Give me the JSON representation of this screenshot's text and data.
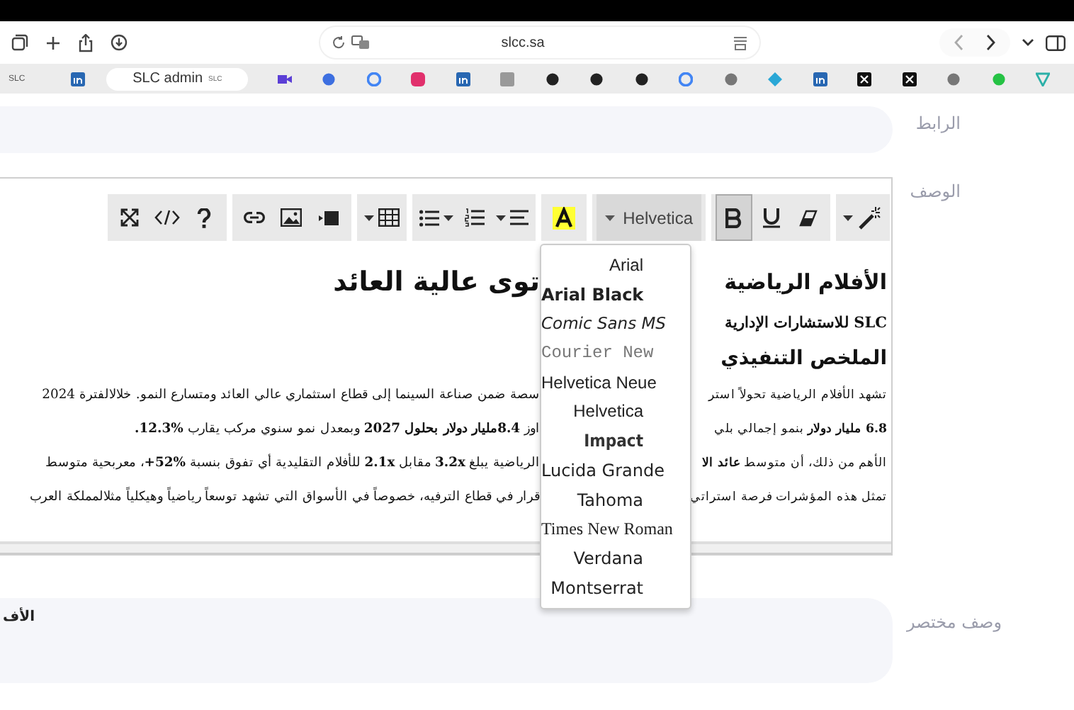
{
  "browser": {
    "address": "slcc.sa",
    "tab_group": "SLC",
    "tabs": [
      {
        "selected": false
      },
      {
        "label": "SLC admin",
        "badge": "SLC",
        "selected": true
      },
      {
        "selected": false
      },
      {
        "selected": false
      },
      {
        "selected": false
      },
      {
        "selected": false
      },
      {
        "selected": false
      },
      {
        "selected": false
      },
      {
        "selected": false
      },
      {
        "selected": false
      },
      {
        "selected": false
      },
      {
        "selected": false
      },
      {
        "selected": false
      },
      {
        "selected": false
      },
      {
        "selected": false
      },
      {
        "selected": false
      },
      {
        "selected": false
      },
      {
        "selected": false
      },
      {
        "selected": false
      },
      {
        "selected": false
      }
    ]
  },
  "form": {
    "link_label": "الرابط",
    "description_label": "الوصف",
    "summary_label": "وصف مختصر",
    "summary_value": "الأف"
  },
  "toolbar": {
    "groups": [
      [
        {
          "kind": "wand",
          "caret": true
        }
      ],
      [
        {
          "kind": "bold",
          "selected": true
        },
        {
          "kind": "underline",
          "selected": false
        },
        {
          "kind": "eraser"
        }
      ],
      [
        {
          "kind": "font",
          "value": "Helvetica",
          "expanded": true
        }
      ],
      [
        {
          "kind": "highlight"
        }
      ],
      [
        {
          "kind": "ul",
          "caret": true
        },
        {
          "kind": "ol"
        },
        {
          "kind": "align",
          "caret": true
        }
      ],
      [
        {
          "kind": "table",
          "caret": true
        }
      ],
      [
        {
          "kind": "link"
        },
        {
          "kind": "image"
        },
        {
          "kind": "video"
        }
      ],
      [
        {
          "kind": "fullscreen"
        },
        {
          "kind": "code"
        },
        {
          "kind": "help"
        }
      ]
    ]
  },
  "font_menu": [
    "Arial",
    "Arial Black",
    "Comic Sans MS",
    "Courier New",
    "Helvetica Neue",
    "Helvetica",
    "Impact",
    "Lucida Grande",
    "Tahoma",
    "Times New Roman",
    "Verdana",
    "Montserrat"
  ],
  "editor": {
    "lines": [
      {
        "kind": "title",
        "left": "توى عالية العائد",
        "right": "الأفلام الرياضية"
      },
      {
        "kind": "subtitle",
        "right": "SLC للاستشارات الإدارية"
      },
      {
        "kind": "heading",
        "right": "الملخص التنفيذي"
      },
      {
        "kind": "body",
        "left": "سصة ضمن صناعة السينما إلى قطاع استثماري عالي العائد ومتسارع النمو. خلالالفترة 2024",
        "right": "تشهد الأفلام الرياضية تحولاً استر"
      },
      {
        "kind": "body",
        "left": "اوز **8.4مليار دولار بحلول 2027** وبمعدل نمو سنوي مركب يقارب **%12.3.**",
        "right": "**6.8 مليار دولار** بنمو إجمالي بلي"
      },
      {
        "kind": "body",
        "left": "الرياضية يبلغ **3.2x** مقابل **2.1x** للأفلام التقليدية أي تفوق بنسبة **%52+**، معربحية متوسط",
        "right": "الأهم من ذلك، أن متوسط **عائد الا**"
      },
      {
        "kind": "body",
        "left": "قرار في قطاع الترفيه، خصوصاً في الأسواق التي تشهد توسعاً رياضياً وهيكلياً مثلالمملكة العرب",
        "right": "تمثل هذه المؤشرات فرصة استراتي"
      }
    ]
  }
}
